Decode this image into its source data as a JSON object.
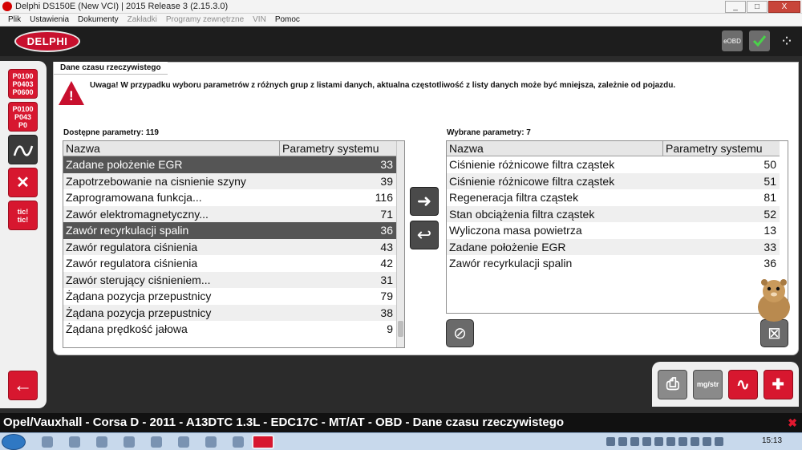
{
  "window": {
    "title": "Delphi DS150E (New VCI) | 2015 Release 3 (2.15.3.0)",
    "minimize": "_",
    "maximize": "□",
    "close": "X"
  },
  "menu": [
    {
      "label": "Plik",
      "enabled": true
    },
    {
      "label": "Ustawienia",
      "enabled": true
    },
    {
      "label": "Dokumenty",
      "enabled": true
    },
    {
      "label": "Zakładki",
      "enabled": false
    },
    {
      "label": "Programy zewnętrzne",
      "enabled": false
    },
    {
      "label": "VIN",
      "enabled": false
    },
    {
      "label": "Pomoc",
      "enabled": true
    }
  ],
  "header": {
    "logo": "DELPHI",
    "eobd": "eOBD",
    "dots": "⁘"
  },
  "sidebar": {
    "btn1": "P0100\nP0403\nP0600",
    "btn2": "P0100\nP043\nP0",
    "btn3": "≈",
    "btn4": "✕",
    "btn5": "tic!\ntic!",
    "back": "←"
  },
  "panel": {
    "tab": "Dane czasu rzeczywistego",
    "warning_mark": "!",
    "warning": "Uwaga!  W przypadku wyboru parametrów z różnych grup z listami danych, aktualna częstotliwość z listy danych może być mniejsza, zależnie od pojazdu.",
    "available_label": "Dostępne parametry: 119",
    "selected_label": "Wybrane parametry: 7",
    "col_name": "Nazwa",
    "col_system": "Parametry systemu",
    "move_right": "➜",
    "move_left": "↩",
    "clear": "⊘",
    "remove": "⊠"
  },
  "available": [
    {
      "name": "Zadane położenie EGR",
      "value": "33",
      "selected": true
    },
    {
      "name": "Zapotrzebowanie na cisnienie szyny",
      "value": "39",
      "selected": false
    },
    {
      "name": "Zaprogramowana  funkcja...",
      "value": "116",
      "selected": false
    },
    {
      "name": "Zawór  elektromagnetyczny...",
      "value": "71",
      "selected": false
    },
    {
      "name": "Zawór recyrkulacji spalin",
      "value": "36",
      "selected": true
    },
    {
      "name": "Zawór regulatora ciśnienia",
      "value": "43",
      "selected": false
    },
    {
      "name": "Zawór regulatora ciśnienia",
      "value": "42",
      "selected": false
    },
    {
      "name": "Zawór sterujący ciśnieniem...",
      "value": "31",
      "selected": false
    },
    {
      "name": "Żądana pozycja przepustnicy",
      "value": "79",
      "selected": false
    },
    {
      "name": "Żądana pozycja przepustnicy",
      "value": "38",
      "selected": false
    },
    {
      "name": "Żądana prędkość jałowa",
      "value": "9",
      "selected": false
    }
  ],
  "chosen": [
    {
      "name": "Ciśnienie różnicowe filtra cząstek",
      "value": "50"
    },
    {
      "name": "Ciśnienie różnicowe filtra cząstek",
      "value": "51"
    },
    {
      "name": "Regeneracja filtra cząstek",
      "value": "81"
    },
    {
      "name": "Stan obciążenia filtra cząstek",
      "value": "52"
    },
    {
      "name": "Wyliczona masa powietrza",
      "value": "13"
    },
    {
      "name": "Zadane położenie EGR",
      "value": "33"
    },
    {
      "name": "Zawór recyrkulacji spalin",
      "value": "36"
    }
  ],
  "toolbar": {
    "print": "⎙",
    "graph": "mg/str",
    "chart": "∿",
    "add": "✚"
  },
  "status": {
    "text": "Opel/Vauxhall - Corsa D - 2011 - A13DTC 1.3L - EDC17C - MT/AT - OBD - Dane czasu rzeczywistego",
    "close": "✖"
  },
  "taskbar": {
    "time": "15:13"
  },
  "colors": {
    "brand_red": "#d7172f",
    "selected_row": "#555555",
    "header_bg": "#1d1d1d"
  }
}
